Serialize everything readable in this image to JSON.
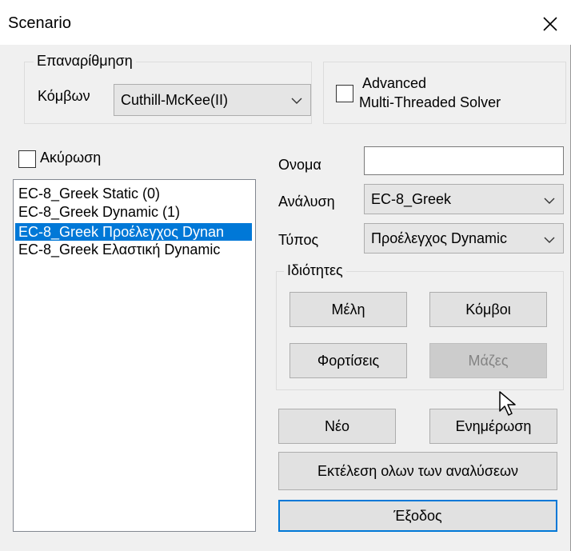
{
  "window": {
    "title": "Scenario"
  },
  "renumbering": {
    "legend": "Επαναρίθμηση",
    "nodes_label": "Κόμβων",
    "method_value": "Cuthill-McKee(II)"
  },
  "solver": {
    "line1": "Advanced",
    "line2": "Multi-Threaded Solver",
    "checked": false
  },
  "cancel": {
    "label": "Ακύρωση",
    "checked": false
  },
  "scenarios": [
    {
      "label": "EC-8_Greek Static (0)",
      "selected": false
    },
    {
      "label": "EC-8_Greek Dynamic (1)",
      "selected": false
    },
    {
      "label": "EC-8_Greek Προέλεγχος Dynan",
      "selected": true
    },
    {
      "label": "EC-8_Greek Ελαστική Dynamic",
      "selected": false
    }
  ],
  "form": {
    "name_label": "Ονομα",
    "name_value": "",
    "analysis_label": "Ανάλυση",
    "analysis_value": "EC-8_Greek",
    "type_label": "Τύπος",
    "type_value": "Προέλεγχος Dynamic"
  },
  "properties": {
    "legend": "Ιδιότητες",
    "members_btn": "Μέλη",
    "nodes_btn": "Κόμβοι",
    "loads_btn": "Φορτίσεις",
    "masses_btn": "Μάζες"
  },
  "actions": {
    "new_btn": "Νέο",
    "update_btn": "Ενημέρωση",
    "run_all_btn": "Εκτέλεση ολων των αναλύσεων",
    "exit_btn": "Έξοδος"
  },
  "icons": {
    "close": "close-icon",
    "chevron": "chevron-down-icon",
    "cursor": "mouse-pointer-icon"
  },
  "colors": {
    "selection": "#0078d7",
    "dialog_bg": "#f0f0f0",
    "button_bg": "#e1e1e1"
  }
}
